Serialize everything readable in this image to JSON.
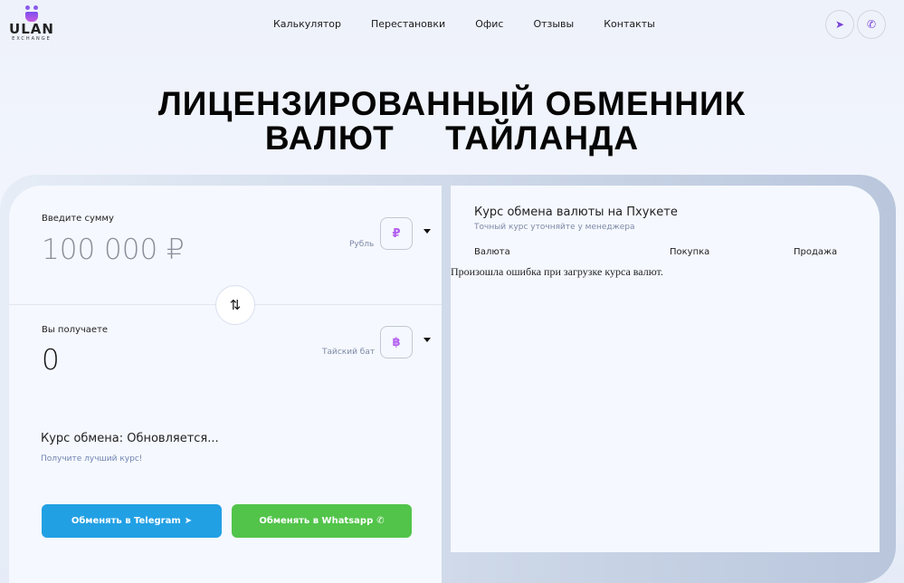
{
  "logo": {
    "name": "ULAN",
    "sub": "EXCHANGE"
  },
  "nav": [
    "Калькулятор",
    "Перестановки",
    "Офис",
    "Отзывы",
    "Контакты"
  ],
  "hero": {
    "line1": "ЛИЦЕНЗИРОВАННЫЙ ОБМЕННИК",
    "line2": "ВАЛЮТ     ТАЙЛАНДА"
  },
  "calc": {
    "give_label": "Введите сумму",
    "give_value": "100 000 ₽",
    "give_currency": "Рубль",
    "give_symbol": "₽",
    "get_label": "Вы получаете",
    "get_value": "0",
    "get_currency": "Тайский бат",
    "get_symbol": "฿",
    "swap": "⇅",
    "rate": "Курс обмена: Обновляется...",
    "rate_hint": "Получите лучший курс!",
    "tg_btn": "Обменять в Telegram",
    "wa_btn": "Обменять в Whatsapp"
  },
  "rates": {
    "title": "Курс обмена валюты на Пхукете",
    "subtitle": "Точный курс уточняйте у менеджера",
    "headers": [
      "Валюта",
      "Покупка",
      "Продажа"
    ],
    "error": "Произошла ошибка при загрузке курса валют."
  },
  "colors": {
    "telegram": "#22a0e4",
    "whatsapp": "#52c44a",
    "accent": "#8a5cf0"
  }
}
